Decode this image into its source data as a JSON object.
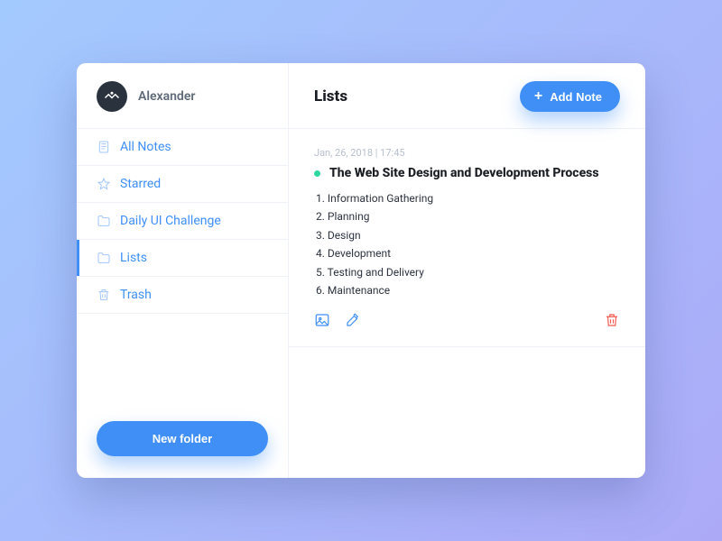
{
  "user": {
    "name": "Alexander"
  },
  "sidebar": {
    "items": [
      {
        "label": "All Notes",
        "icon": "note-icon",
        "active": false
      },
      {
        "label": "Starred",
        "icon": "star-icon",
        "active": false
      },
      {
        "label": "Daily UI Challenge",
        "icon": "folder-icon",
        "active": false
      },
      {
        "label": "Lists",
        "icon": "folder-icon",
        "active": true
      },
      {
        "label": "Trash",
        "icon": "trash-icon",
        "active": false
      }
    ],
    "new_folder_label": "New folder"
  },
  "header": {
    "title": "Lists",
    "add_note_label": "Add Note"
  },
  "note": {
    "date": "Jan, 26, 2018",
    "time": "17:45",
    "meta_separator": "  |  ",
    "title": "The Web Site Design and Development Process",
    "body_lines": [
      "1. Information Gathering",
      "2. Planning",
      "3. Design",
      "4. Development",
      "5. Testing and Delivery",
      "6. Maintenance"
    ],
    "status_color": "#2bd9a0"
  }
}
